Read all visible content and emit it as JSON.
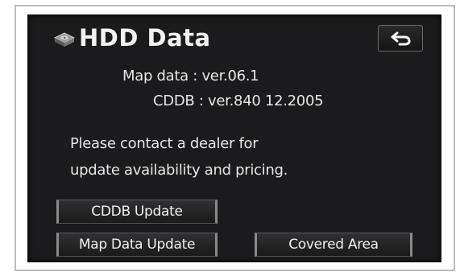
{
  "header": {
    "title": "HDD Data",
    "title_icon": "hdd-disc-icon",
    "back_icon": "return-arrow-icon"
  },
  "info": {
    "map_data": "Map data : ver.06.1",
    "cddb": "CDDB : ver.840 12.2005"
  },
  "message": {
    "line1": "Please contact a dealer for",
    "line2": "update availability and pricing."
  },
  "buttons": {
    "cddb_update": "CDDB Update",
    "map_data_update": "Map Data Update",
    "covered_area": "Covered Area"
  },
  "colors": {
    "screen_background": "#1b1b1d",
    "text": "#ececec"
  }
}
